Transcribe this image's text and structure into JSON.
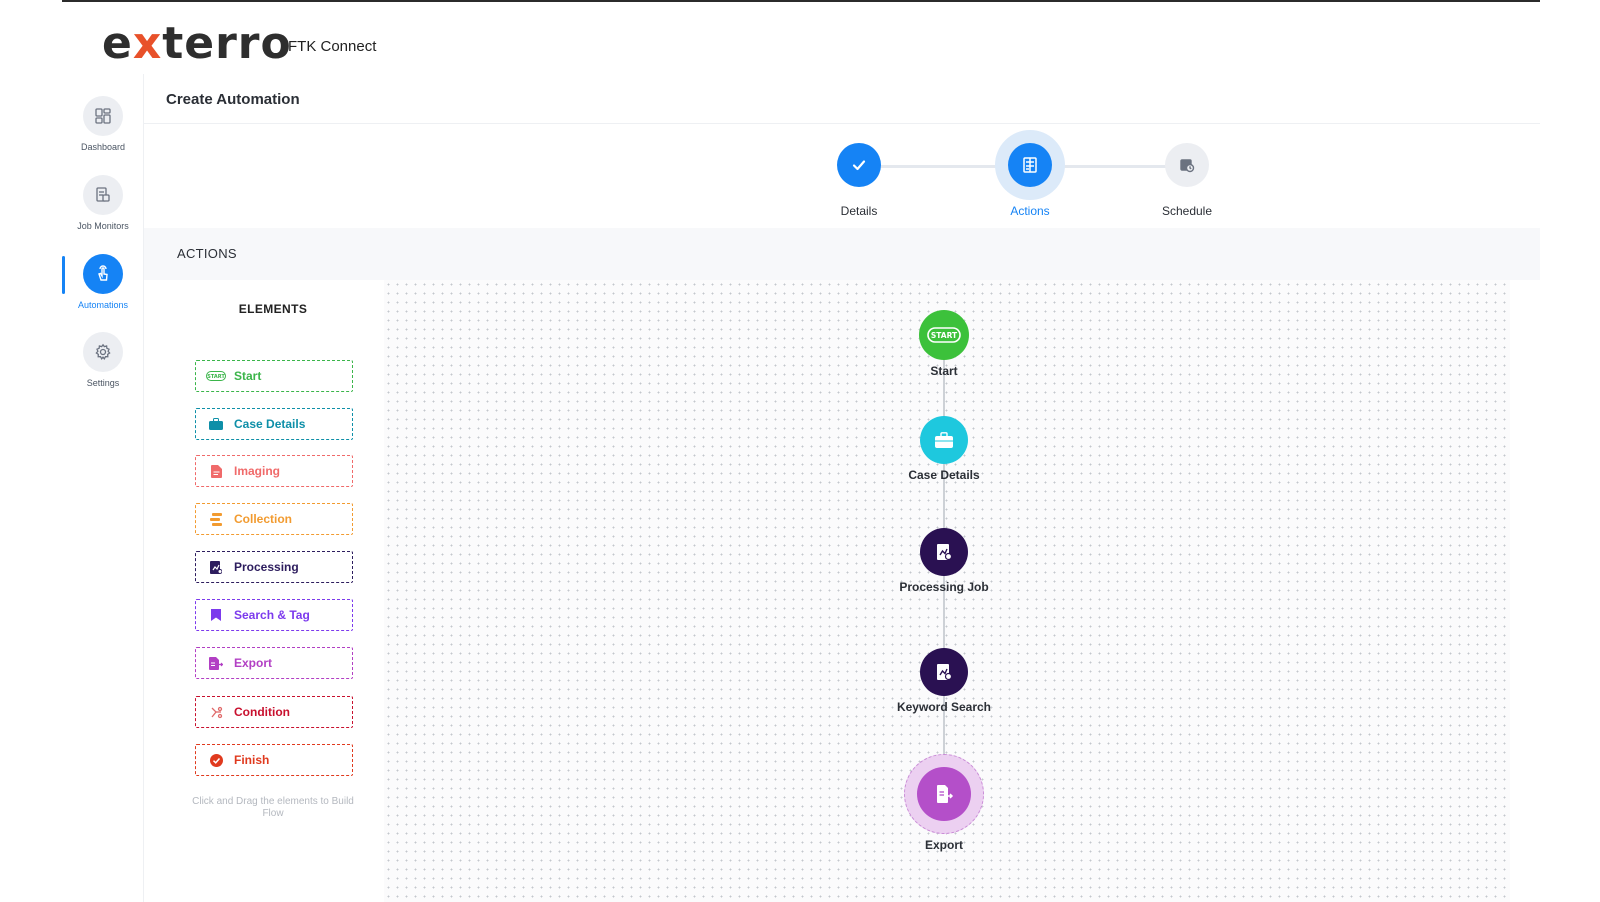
{
  "app": {
    "logo_prefix": "e",
    "logo_x": "x",
    "logo_suffix": "terro",
    "product": "FTK Connect"
  },
  "nav": [
    {
      "label": "Dashboard",
      "icon": "dashboard-icon",
      "active": false
    },
    {
      "label": "Job Monitors",
      "icon": "job-monitor-icon",
      "active": false
    },
    {
      "label": "Automations",
      "icon": "automation-hand-icon",
      "active": true
    },
    {
      "label": "Settings",
      "icon": "gear-icon",
      "active": false
    }
  ],
  "page": {
    "title": "Create Automation"
  },
  "stepper": [
    {
      "label": "Details",
      "state": "complete"
    },
    {
      "label": "Actions",
      "state": "current"
    },
    {
      "label": "Schedule",
      "state": "pending"
    }
  ],
  "actions": {
    "title": "ACTIONS"
  },
  "elements": {
    "title": "ELEMENTS",
    "items": [
      {
        "label": "Start",
        "color": "#3bb54a",
        "icon": "start-badge-icon"
      },
      {
        "label": "Case Details",
        "color": "#0e8fa8",
        "icon": "briefcase-icon"
      },
      {
        "label": "Imaging",
        "color": "#f06a6a",
        "icon": "document-icon"
      },
      {
        "label": "Collection",
        "color": "#f29b30",
        "icon": "collection-icon"
      },
      {
        "label": "Processing",
        "color": "#2d1d5e",
        "icon": "processing-icon"
      },
      {
        "label": "Search & Tag",
        "color": "#7c3aed",
        "icon": "bookmark-icon"
      },
      {
        "label": "Export",
        "color": "#b23fc4",
        "icon": "export-icon"
      },
      {
        "label": "Condition",
        "color": "#c8102e",
        "icon": "condition-icon"
      },
      {
        "label": "Finish",
        "color": "#e03a1e",
        "icon": "check-circle-icon"
      }
    ],
    "hint": "Click and Drag the elements to Build Flow"
  },
  "flow": [
    {
      "label": "Start",
      "color": "#3cc13b",
      "icon": "start-badge-icon"
    },
    {
      "label": "Case Details",
      "color": "#1ec8de",
      "icon": "briefcase-icon"
    },
    {
      "label": "Processing Job",
      "color": "#2a1152",
      "icon": "processing-icon"
    },
    {
      "label": "Keyword Search",
      "color": "#2a1152",
      "icon": "processing-icon"
    },
    {
      "label": "Export",
      "color": "#b44fc9",
      "icon": "export-icon"
    }
  ],
  "colors": {
    "accent": "#1583f5",
    "logo_x": "#e8512a"
  }
}
